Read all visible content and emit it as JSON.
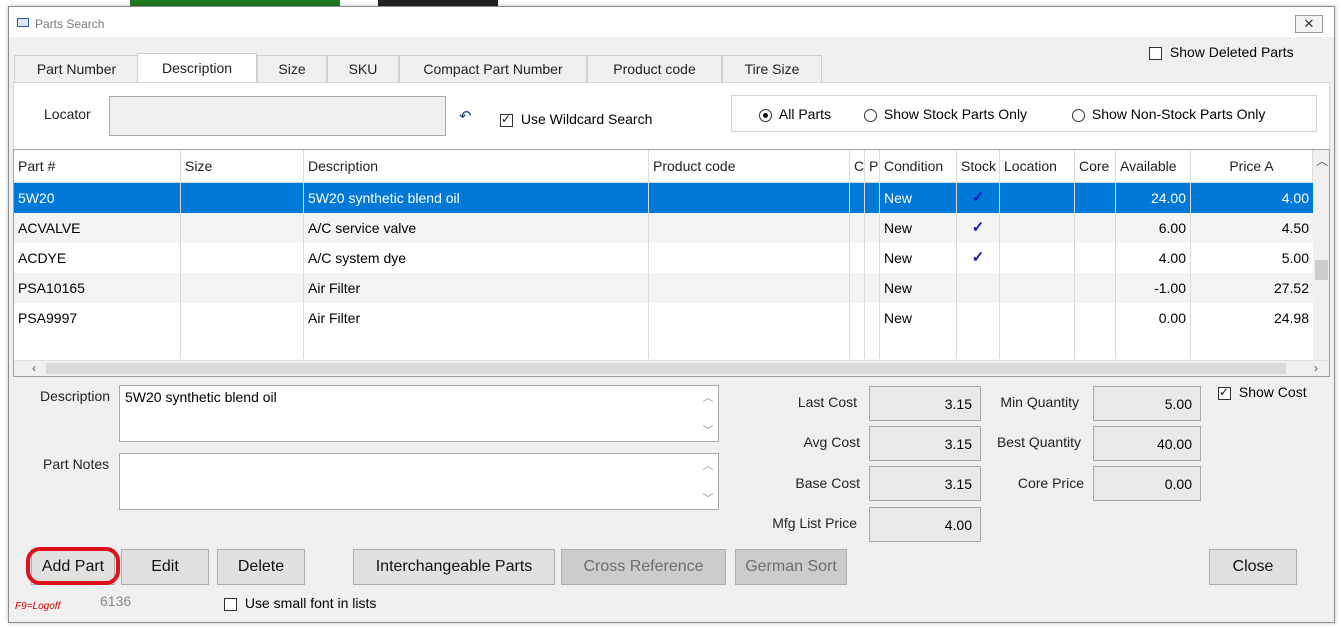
{
  "window": {
    "title": "Parts Search",
    "close_glyph": "✕"
  },
  "tabs": [
    {
      "label": "Part Number",
      "active": false
    },
    {
      "label": "Description",
      "active": true
    },
    {
      "label": "Size",
      "active": false
    },
    {
      "label": "SKU",
      "active": false
    },
    {
      "label": "Compact Part Number",
      "active": false
    },
    {
      "label": "Product code",
      "active": false
    },
    {
      "label": "Tire Size",
      "active": false
    }
  ],
  "show_deleted": {
    "label": "Show Deleted Parts",
    "checked": false
  },
  "locator": {
    "label": "Locator",
    "value": "",
    "undo_icon": "↶"
  },
  "wildcard": {
    "label": "Use Wildcard Search",
    "checked": true
  },
  "filter": {
    "options": [
      {
        "label": "All Parts",
        "selected": true
      },
      {
        "label": "Show Stock Parts Only",
        "selected": false
      },
      {
        "label": "Show Non-Stock Parts Only",
        "selected": false
      }
    ]
  },
  "grid": {
    "columns": [
      "Part #",
      "Size",
      "Description",
      "Product code",
      "C",
      "P",
      "Condition",
      "Stock",
      "Location",
      "Core",
      "Available",
      "Price A"
    ],
    "rows": [
      {
        "part": "5W20",
        "size": "",
        "desc": "5W20 synthetic blend oil",
        "product": "",
        "c": "",
        "p": "",
        "condition": "New",
        "stock": "✓",
        "location": "",
        "core": "",
        "available": "24.00",
        "price_a": "4.00"
      },
      {
        "part": "ACVALVE",
        "size": "",
        "desc": "A/C service valve",
        "product": "",
        "c": "",
        "p": "",
        "condition": "New",
        "stock": "✓",
        "location": "",
        "core": "",
        "available": "6.00",
        "price_a": "4.50"
      },
      {
        "part": "ACDYE",
        "size": "",
        "desc": "A/C system dye",
        "product": "",
        "c": "",
        "p": "",
        "condition": "New",
        "stock": "✓",
        "location": "",
        "core": "",
        "available": "4.00",
        "price_a": "5.00"
      },
      {
        "part": "PSA10165",
        "size": "",
        "desc": "Air Filter",
        "product": "",
        "c": "",
        "p": "",
        "condition": "New",
        "stock": "",
        "location": "",
        "core": "",
        "available": "-1.00",
        "price_a": "27.52"
      },
      {
        "part": "PSA9997",
        "size": "",
        "desc": "Air Filter",
        "product": "",
        "c": "",
        "p": "",
        "condition": "New",
        "stock": "",
        "location": "",
        "core": "",
        "available": "0.00",
        "price_a": "24.98"
      }
    ],
    "selected_index": 0
  },
  "details": {
    "description_label": "Description",
    "description_value": "5W20 synthetic blend oil",
    "notes_label": "Part Notes",
    "notes_value": "",
    "last_cost_label": "Last Cost",
    "last_cost": "3.15",
    "avg_cost_label": "Avg Cost",
    "avg_cost": "3.15",
    "base_cost_label": "Base Cost",
    "base_cost": "3.15",
    "mfg_list_label": "Mfg List Price",
    "mfg_list": "4.00",
    "min_qty_label": "Min Quantity",
    "min_qty": "5.00",
    "best_qty_label": "Best Quantity",
    "best_qty": "40.00",
    "core_price_label": "Core Price",
    "core_price": "0.00",
    "show_cost_label": "Show Cost",
    "show_cost": true
  },
  "buttons": {
    "add_part": "Add Part",
    "edit": "Edit",
    "delete": "Delete",
    "interchangeable": "Interchangeable Parts",
    "cross_reference": "Cross Reference",
    "german_sort": "German Sort",
    "close": "Close"
  },
  "footer": {
    "logoff_hint": "F9=Logoff",
    "code": "6136",
    "small_font_label": "Use small font in lists",
    "small_font": false
  },
  "colors": {
    "selection": "#0078d7",
    "highlight_ring": "#e0101a",
    "check_blue": "#1414c8"
  }
}
